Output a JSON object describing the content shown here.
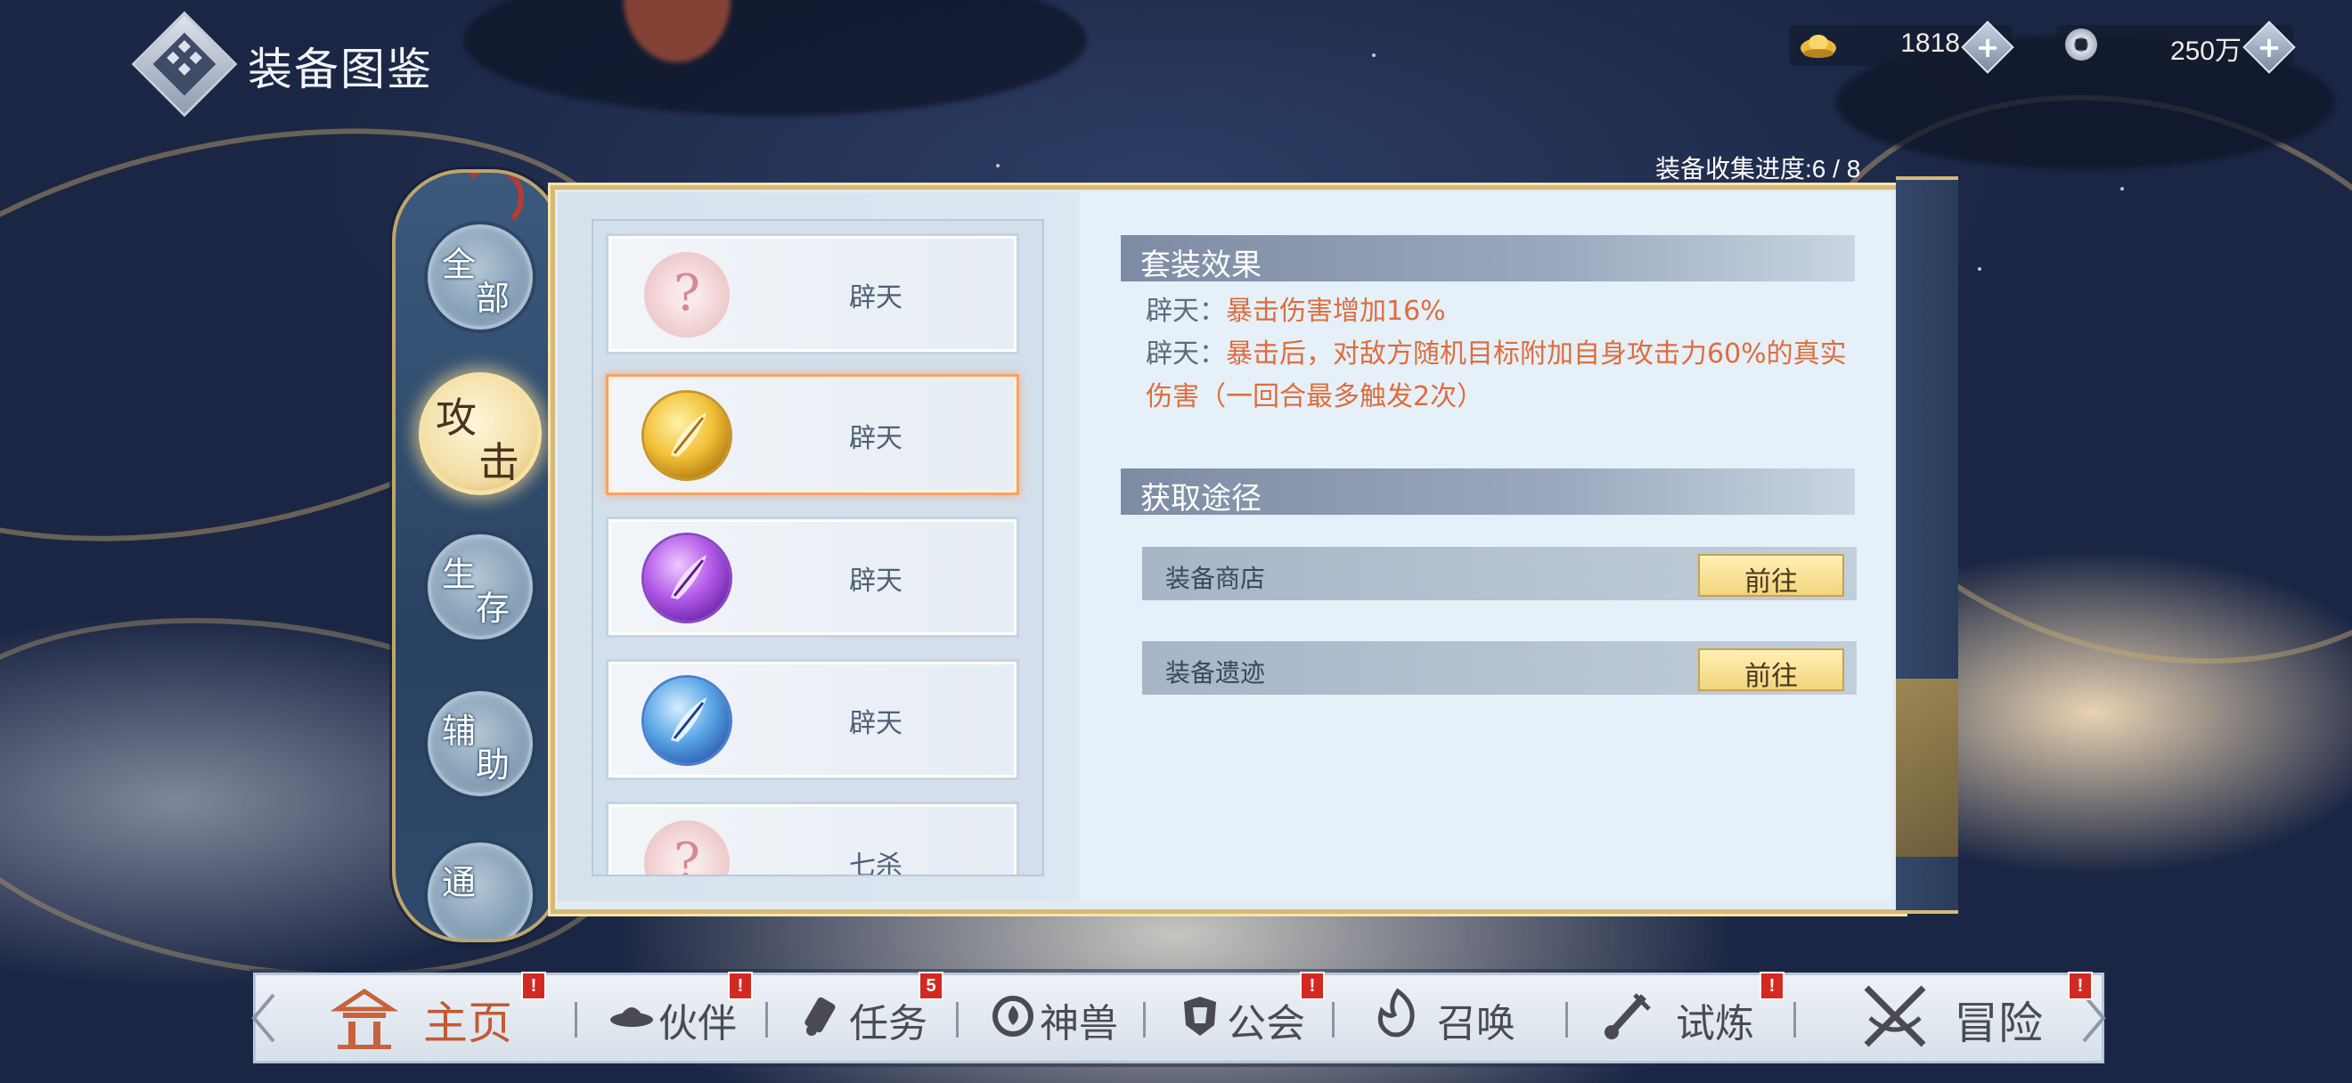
{
  "header": {
    "title": "装备图鉴"
  },
  "currencies": {
    "ingot": {
      "icon": "gold-ingot-icon",
      "value": "1818"
    },
    "coin": {
      "icon": "coin-icon",
      "value": "250万"
    }
  },
  "collection": {
    "progress_text": "装备收集进度:6 / 8",
    "collected": 6,
    "total": 8
  },
  "side_tabs": [
    {
      "c1": "全",
      "c2": "部",
      "active": false
    },
    {
      "c1": "攻",
      "c2": "击",
      "active": true
    },
    {
      "c1": "生",
      "c2": "存",
      "active": false
    },
    {
      "c1": "辅",
      "c2": "助",
      "active": false
    },
    {
      "c1": "通",
      "c2": "",
      "active": false
    }
  ],
  "equipment_list": [
    {
      "name": "辟天",
      "icon": "unknown-orb-icon",
      "rarity": "unknown",
      "selected": false
    },
    {
      "name": "辟天",
      "icon": "gold-feather-orb-icon",
      "rarity": "gold",
      "selected": true
    },
    {
      "name": "辟天",
      "icon": "purple-feather-orb-icon",
      "rarity": "purple",
      "selected": false
    },
    {
      "name": "辟天",
      "icon": "blue-feather-orb-icon",
      "rarity": "blue",
      "selected": false
    },
    {
      "name": "七杀",
      "icon": "unknown-orb-icon",
      "rarity": "unknown",
      "selected": false
    }
  ],
  "set_effect": {
    "heading": "套装效果",
    "lines": [
      {
        "key": "辟天：",
        "text": "暴击伤害增加16%"
      },
      {
        "key": "辟天：",
        "text": "暴击后，对敌方随机目标附加自身攻击力60%的真实伤害（一回合最多触发2次）"
      }
    ]
  },
  "sources": {
    "heading": "获取途径",
    "items": [
      {
        "label": "装备商店",
        "button": "前往"
      },
      {
        "label": "装备遗迹",
        "button": "前往"
      }
    ]
  },
  "bottom_nav": [
    {
      "label": "主页",
      "icon": "home-pavilion-icon",
      "badge": "!"
    },
    {
      "label": "伙伴",
      "icon": "partner-hat-icon",
      "badge": "!"
    },
    {
      "label": "任务",
      "icon": "task-scroll-icon",
      "badge": "5"
    },
    {
      "label": "神兽",
      "icon": "beast-swirl-icon",
      "badge": ""
    },
    {
      "label": "公会",
      "icon": "guild-shield-icon",
      "badge": "!"
    },
    {
      "label": "召唤",
      "icon": "summon-flame-icon",
      "badge": ""
    },
    {
      "label": "试炼",
      "icon": "trial-sword-icon",
      "badge": "!"
    },
    {
      "label": "冒险",
      "icon": "adventure-swords-icon",
      "badge": "!"
    }
  ],
  "colors": {
    "accent_orange": "#de6d3c",
    "badge_red": "#d22a22",
    "book_gold": "#d8b973"
  }
}
